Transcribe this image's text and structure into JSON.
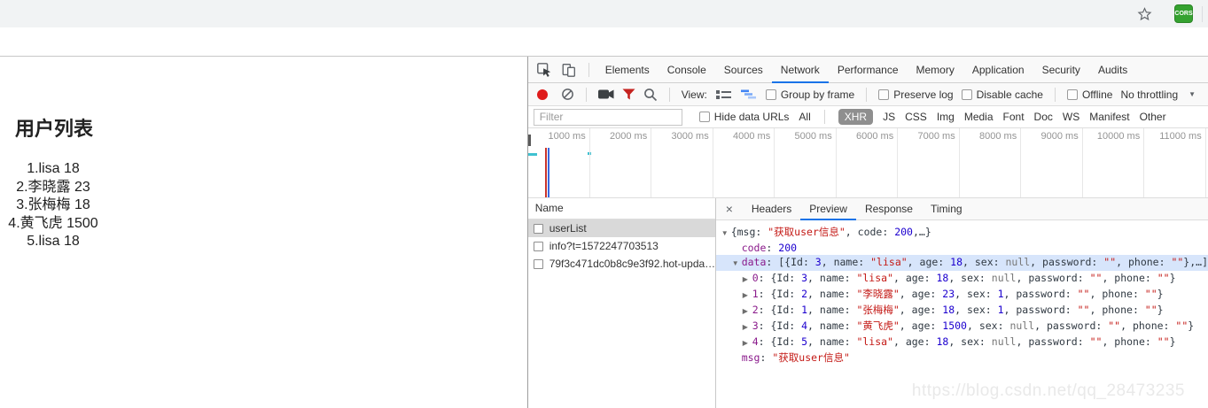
{
  "browser": {
    "extension_badge": "CORS"
  },
  "page": {
    "title": "用户列表",
    "users": [
      "1.lisa 18",
      "2.李晓露 23",
      "3.张梅梅 18",
      "4.黄飞虎 1500",
      "5.lisa 18"
    ]
  },
  "devtools": {
    "tabs": [
      {
        "label": "Elements"
      },
      {
        "label": "Console"
      },
      {
        "label": "Sources"
      },
      {
        "label": "Network",
        "active": true
      },
      {
        "label": "Performance"
      },
      {
        "label": "Memory"
      },
      {
        "label": "Application"
      },
      {
        "label": "Security"
      },
      {
        "label": "Audits"
      }
    ],
    "toolbar": {
      "view_label": "View:",
      "group_by_frame": "Group by frame",
      "preserve_log": "Preserve log",
      "disable_cache": "Disable cache",
      "offline": "Offline",
      "throttling": "No throttling"
    },
    "filter_bar": {
      "placeholder": "Filter",
      "hide_label": "Hide data URLs",
      "types": [
        {
          "label": "All"
        },
        {
          "label": "XHR",
          "active": true
        },
        {
          "label": "JS"
        },
        {
          "label": "CSS"
        },
        {
          "label": "Img"
        },
        {
          "label": "Media"
        },
        {
          "label": "Font"
        },
        {
          "label": "Doc"
        },
        {
          "label": "WS"
        },
        {
          "label": "Manifest"
        },
        {
          "label": "Other"
        }
      ]
    },
    "timeline": {
      "ticks": [
        "1000 ms",
        "2000 ms",
        "3000 ms",
        "4000 ms",
        "5000 ms",
        "6000 ms",
        "7000 ms",
        "8000 ms",
        "9000 ms",
        "10000 ms",
        "11000 ms"
      ]
    },
    "network": {
      "name_header": "Name",
      "requests": [
        {
          "name": "userList",
          "selected": true
        },
        {
          "name": "info?t=1572247703513"
        },
        {
          "name": "79f3c471dc0b8c9e3f92.hot-upda…"
        }
      ]
    },
    "details": {
      "close_label": "×",
      "tabs": [
        {
          "label": "Headers"
        },
        {
          "label": "Preview",
          "active": true
        },
        {
          "label": "Response"
        },
        {
          "label": "Timing"
        }
      ],
      "preview_lines": [
        {
          "indent": 0,
          "expander": "open",
          "segments": [
            {
              "t": "{msg: ",
              "c": "plain"
            },
            {
              "t": "\"获取user信息\"",
              "c": "str"
            },
            {
              "t": ", code: ",
              "c": "plain"
            },
            {
              "t": "200",
              "c": "num"
            },
            {
              "t": ",…}",
              "c": "plain"
            }
          ]
        },
        {
          "indent": 1,
          "segments": [
            {
              "t": "code",
              "c": "key"
            },
            {
              "t": ": ",
              "c": "plain"
            },
            {
              "t": "200",
              "c": "num"
            }
          ]
        },
        {
          "indent": 1,
          "expander": "open",
          "selected": true,
          "segments": [
            {
              "t": "data",
              "c": "key"
            },
            {
              "t": ": [{Id: ",
              "c": "plain"
            },
            {
              "t": "3",
              "c": "num"
            },
            {
              "t": ", name: ",
              "c": "plain"
            },
            {
              "t": "\"lisa\"",
              "c": "str"
            },
            {
              "t": ", age: ",
              "c": "plain"
            },
            {
              "t": "18",
              "c": "num"
            },
            {
              "t": ", sex: ",
              "c": "plain"
            },
            {
              "t": "null",
              "c": "null"
            },
            {
              "t": ", password: ",
              "c": "plain"
            },
            {
              "t": "\"\"",
              "c": "str"
            },
            {
              "t": ", phone: ",
              "c": "plain"
            },
            {
              "t": "\"\"",
              "c": "str"
            },
            {
              "t": "},…]",
              "c": "plain"
            }
          ]
        },
        {
          "indent": 2,
          "expander": "closed",
          "segments": [
            {
              "t": "0",
              "c": "key"
            },
            {
              "t": ": {Id: ",
              "c": "plain"
            },
            {
              "t": "3",
              "c": "num"
            },
            {
              "t": ", name: ",
              "c": "plain"
            },
            {
              "t": "\"lisa\"",
              "c": "str"
            },
            {
              "t": ", age: ",
              "c": "plain"
            },
            {
              "t": "18",
              "c": "num"
            },
            {
              "t": ", sex: ",
              "c": "plain"
            },
            {
              "t": "null",
              "c": "null"
            },
            {
              "t": ", password: ",
              "c": "plain"
            },
            {
              "t": "\"\"",
              "c": "str"
            },
            {
              "t": ", phone: ",
              "c": "plain"
            },
            {
              "t": "\"\"",
              "c": "str"
            },
            {
              "t": "}",
              "c": "plain"
            }
          ]
        },
        {
          "indent": 2,
          "expander": "closed",
          "segments": [
            {
              "t": "1",
              "c": "key"
            },
            {
              "t": ": {Id: ",
              "c": "plain"
            },
            {
              "t": "2",
              "c": "num"
            },
            {
              "t": ", name: ",
              "c": "plain"
            },
            {
              "t": "\"李晓露\"",
              "c": "str"
            },
            {
              "t": ", age: ",
              "c": "plain"
            },
            {
              "t": "23",
              "c": "num"
            },
            {
              "t": ", sex: ",
              "c": "plain"
            },
            {
              "t": "1",
              "c": "num"
            },
            {
              "t": ", password: ",
              "c": "plain"
            },
            {
              "t": "\"\"",
              "c": "str"
            },
            {
              "t": ", phone: ",
              "c": "plain"
            },
            {
              "t": "\"\"",
              "c": "str"
            },
            {
              "t": "}",
              "c": "plain"
            }
          ]
        },
        {
          "indent": 2,
          "expander": "closed",
          "segments": [
            {
              "t": "2",
              "c": "key"
            },
            {
              "t": ": {Id: ",
              "c": "plain"
            },
            {
              "t": "1",
              "c": "num"
            },
            {
              "t": ", name: ",
              "c": "plain"
            },
            {
              "t": "\"张梅梅\"",
              "c": "str"
            },
            {
              "t": ", age: ",
              "c": "plain"
            },
            {
              "t": "18",
              "c": "num"
            },
            {
              "t": ", sex: ",
              "c": "plain"
            },
            {
              "t": "1",
              "c": "num"
            },
            {
              "t": ", password: ",
              "c": "plain"
            },
            {
              "t": "\"\"",
              "c": "str"
            },
            {
              "t": ", phone: ",
              "c": "plain"
            },
            {
              "t": "\"\"",
              "c": "str"
            },
            {
              "t": "}",
              "c": "plain"
            }
          ]
        },
        {
          "indent": 2,
          "expander": "closed",
          "segments": [
            {
              "t": "3",
              "c": "key"
            },
            {
              "t": ": {Id: ",
              "c": "plain"
            },
            {
              "t": "4",
              "c": "num"
            },
            {
              "t": ", name: ",
              "c": "plain"
            },
            {
              "t": "\"黄飞虎\"",
              "c": "str"
            },
            {
              "t": ", age: ",
              "c": "plain"
            },
            {
              "t": "1500",
              "c": "num"
            },
            {
              "t": ", sex: ",
              "c": "plain"
            },
            {
              "t": "null",
              "c": "null"
            },
            {
              "t": ", password: ",
              "c": "plain"
            },
            {
              "t": "\"\"",
              "c": "str"
            },
            {
              "t": ", phone: ",
              "c": "plain"
            },
            {
              "t": "\"\"",
              "c": "str"
            },
            {
              "t": "}",
              "c": "plain"
            }
          ]
        },
        {
          "indent": 2,
          "expander": "closed",
          "segments": [
            {
              "t": "4",
              "c": "key"
            },
            {
              "t": ": {Id: ",
              "c": "plain"
            },
            {
              "t": "5",
              "c": "num"
            },
            {
              "t": ", name: ",
              "c": "plain"
            },
            {
              "t": "\"lisa\"",
              "c": "str"
            },
            {
              "t": ", age: ",
              "c": "plain"
            },
            {
              "t": "18",
              "c": "num"
            },
            {
              "t": ", sex: ",
              "c": "plain"
            },
            {
              "t": "null",
              "c": "null"
            },
            {
              "t": ", password: ",
              "c": "plain"
            },
            {
              "t": "\"\"",
              "c": "str"
            },
            {
              "t": ", phone: ",
              "c": "plain"
            },
            {
              "t": "\"\"",
              "c": "str"
            },
            {
              "t": "}",
              "c": "plain"
            }
          ]
        },
        {
          "indent": 1,
          "segments": [
            {
              "t": "msg",
              "c": "key"
            },
            {
              "t": ": ",
              "c": "plain"
            },
            {
              "t": "\"获取user信息\"",
              "c": "str"
            }
          ]
        }
      ]
    }
  },
  "watermark": "https://blog.csdn.net/qq_28473235",
  "colors": {
    "accent_blue": "#1a73e8",
    "record_red": "#df1b1b",
    "funnel_red": "#c5221f",
    "selected_row_gray": "#d9d9d9",
    "selected_line_blue": "#d7e5fb",
    "extension_green": "#35a230"
  }
}
